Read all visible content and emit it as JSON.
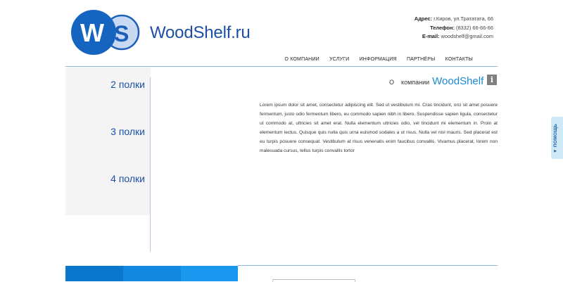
{
  "header": {
    "logo_text": "WS",
    "site_name": "WoodShelf.ru",
    "address_label": "Адрес:",
    "address_value": "г.Киров, ул.Тратататa, 66",
    "phone_label": "Телефон:",
    "phone_value": "(8332) 66-66-66",
    "email_label": "E-mail:",
    "email_value": "woodshelf@gmail.com"
  },
  "nav": [
    "О КОМПАНИИ",
    "УСЛУГИ",
    "ИНФОРМАЦИЯ",
    "ПАРТНЁРЫ",
    "КОНТАКТЫ"
  ],
  "sidebar": {
    "items": [
      "2 полки",
      "3 полки",
      "4 полки"
    ]
  },
  "about": {
    "prefix1": "О",
    "prefix2": "компании",
    "title": "WoodShelf",
    "info_icon": "info-icon",
    "text": "Lorem ipsum dolor sit amet, consectetur adipiscing elit. Sed ut vestibulum mi. Cras tincidunt, orci sit amet posuere fermentum, justo odio fermentum libero, eu commodo sapien nibh in libero. Suspendisse sapien ligula, consectetur ut commodo at, ultricies sit amet erat. Nulla elementum ultricies odio, vel tincidunt mi elementum in. Proin at elementum lectus. Quisque quis nulla quis urna euismod sodales a ut risus. Nulla vel nisl mauris. Sed placerat est eu turpis posuere consequat. Vestibulum at risus venenatis enim faucibus convallis. Vivamus placerat, lorem non malesuada cursus, tellus turpis convallis tortor"
  },
  "help": {
    "label": "▼ ПОМОЩЬ"
  },
  "colors": {
    "brand_blue": "#1b4fa6",
    "accent_blue": "#1b8ad4"
  }
}
